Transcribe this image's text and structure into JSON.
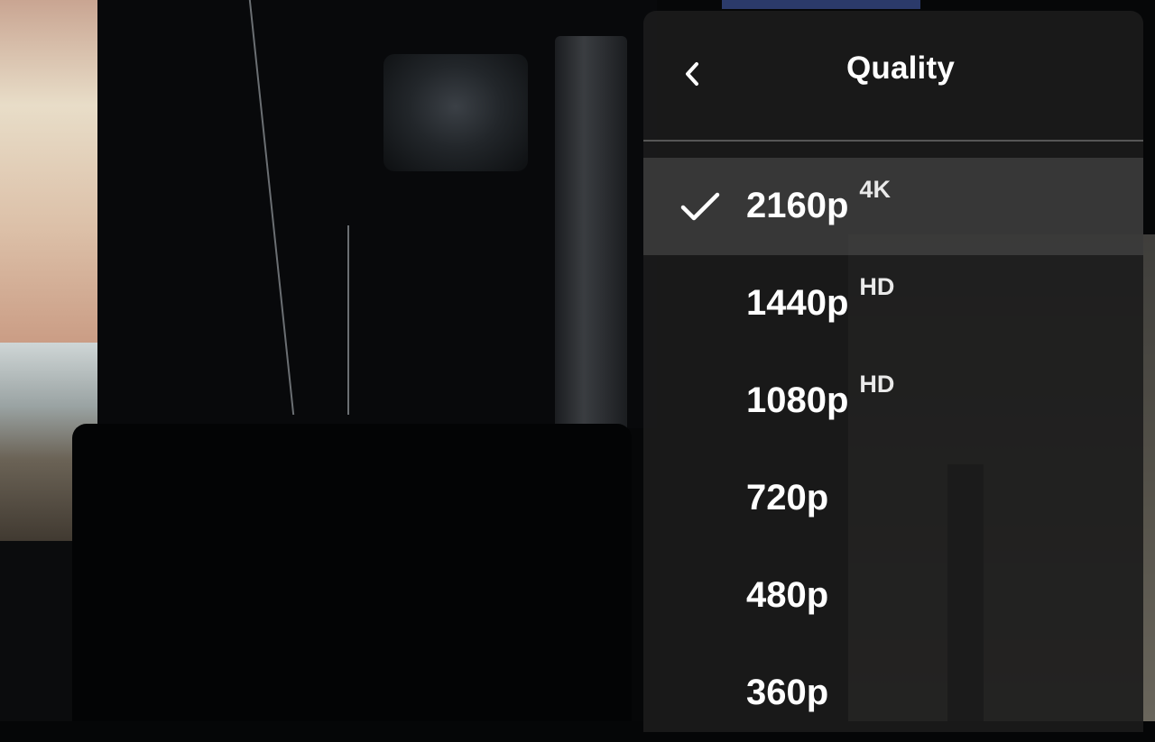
{
  "quality_menu": {
    "title": "Quality",
    "back_icon": "chevron-left-icon",
    "selected_icon": "checkmark-icon",
    "options": [
      {
        "label": "2160p",
        "badge": "4K",
        "selected": true
      },
      {
        "label": "1440p",
        "badge": "HD",
        "selected": false
      },
      {
        "label": "1080p",
        "badge": "HD",
        "selected": false
      },
      {
        "label": "720p",
        "badge": "",
        "selected": false
      },
      {
        "label": "480p",
        "badge": "",
        "selected": false
      },
      {
        "label": "360p",
        "badge": "",
        "selected": false
      }
    ]
  },
  "colors": {
    "panel_bg": "#1c1c1c",
    "text": "#ffffff",
    "selected_row": "#505050"
  }
}
